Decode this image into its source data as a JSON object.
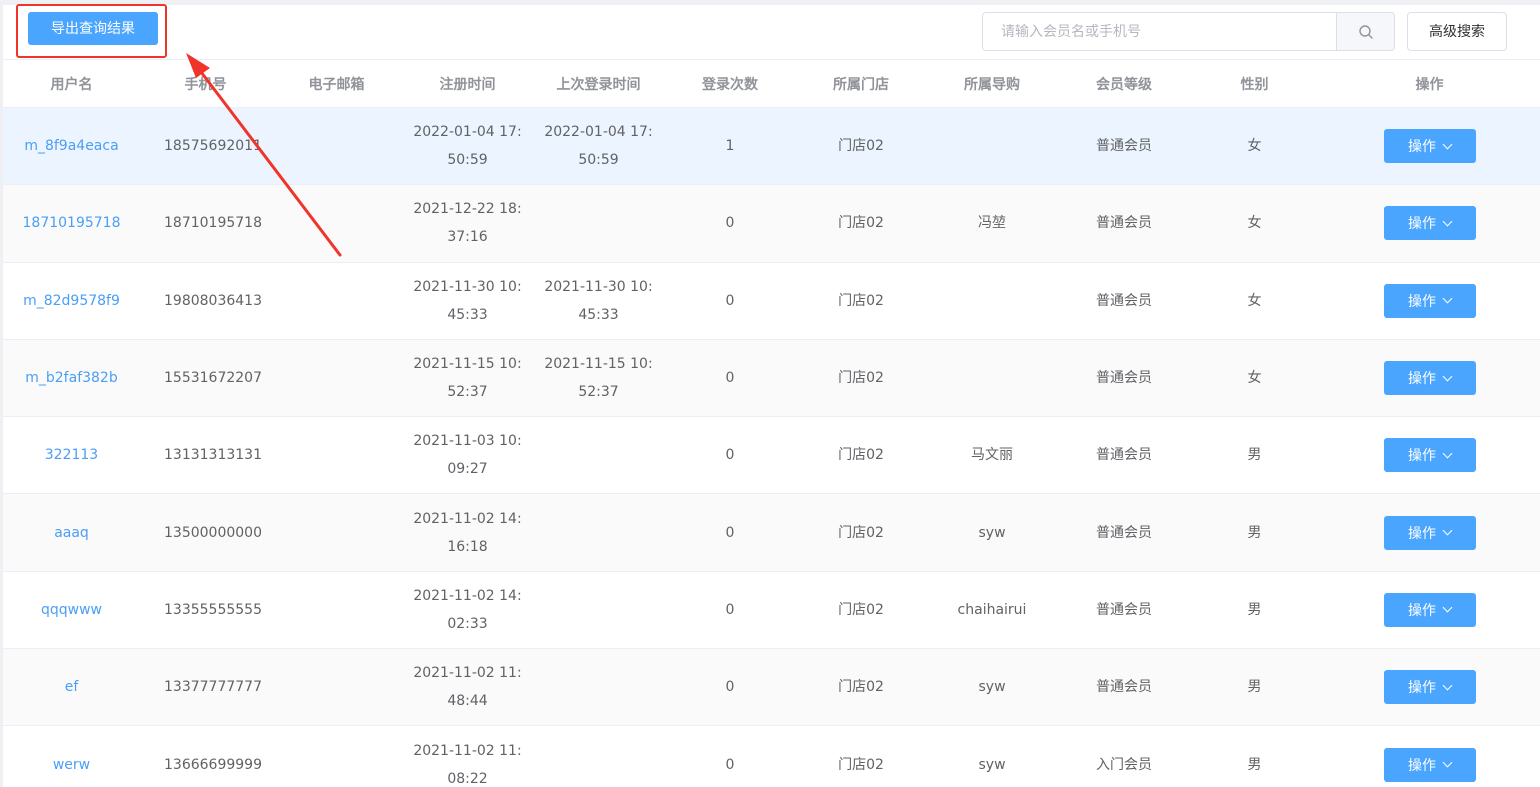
{
  "toolbar": {
    "export_label": "导出查询结果",
    "search_placeholder": "请输入会员名或手机号",
    "advanced_label": "高级搜索"
  },
  "table": {
    "headers": {
      "username": "用户名",
      "phone": "手机号",
      "email": "电子邮箱",
      "register_time": "注册时间",
      "last_login": "上次登录时间",
      "login_count": "登录次数",
      "store": "所属门店",
      "guide": "所属导购",
      "level": "会员等级",
      "gender": "性别",
      "actions": "操作"
    },
    "rows": [
      {
        "username": "m_8f9a4eaca",
        "phone": "18575692011",
        "email": "",
        "reg_date": "2022-01-04 17:",
        "reg_time": "50:59",
        "last_date": "2022-01-04 17:",
        "last_time": "50:59",
        "count": "1",
        "store": "门店02",
        "guide": "",
        "level": "普通会员",
        "gender": "女",
        "action": "操作"
      },
      {
        "username": "18710195718",
        "phone": "18710195718",
        "email": "",
        "reg_date": "2021-12-22 18:",
        "reg_time": "37:16",
        "last_date": "",
        "last_time": "",
        "count": "0",
        "store": "门店02",
        "guide": "冯堃",
        "level": "普通会员",
        "gender": "女",
        "action": "操作"
      },
      {
        "username": "m_82d9578f9",
        "phone": "19808036413",
        "email": "",
        "reg_date": "2021-11-30 10:",
        "reg_time": "45:33",
        "last_date": "2021-11-30 10:",
        "last_time": "45:33",
        "count": "0",
        "store": "门店02",
        "guide": "",
        "level": "普通会员",
        "gender": "女",
        "action": "操作"
      },
      {
        "username": "m_b2faf382b",
        "phone": "15531672207",
        "email": "",
        "reg_date": "2021-11-15 10:",
        "reg_time": "52:37",
        "last_date": "2021-11-15 10:",
        "last_time": "52:37",
        "count": "0",
        "store": "门店02",
        "guide": "",
        "level": "普通会员",
        "gender": "女",
        "action": "操作"
      },
      {
        "username": "322113",
        "phone": "13131313131",
        "email": "",
        "reg_date": "2021-11-03 10:",
        "reg_time": "09:27",
        "last_date": "",
        "last_time": "",
        "count": "0",
        "store": "门店02",
        "guide": "马文丽",
        "level": "普通会员",
        "gender": "男",
        "action": "操作"
      },
      {
        "username": "aaaq",
        "phone": "13500000000",
        "email": "",
        "reg_date": "2021-11-02 14:",
        "reg_time": "16:18",
        "last_date": "",
        "last_time": "",
        "count": "0",
        "store": "门店02",
        "guide": "syw",
        "level": "普通会员",
        "gender": "男",
        "action": "操作"
      },
      {
        "username": "qqqwww",
        "phone": "13355555555",
        "email": "",
        "reg_date": "2021-11-02 14:",
        "reg_time": "02:33",
        "last_date": "",
        "last_time": "",
        "count": "0",
        "store": "门店02",
        "guide": "chaihairui",
        "level": "普通会员",
        "gender": "男",
        "action": "操作"
      },
      {
        "username": "ef",
        "phone": "13377777777",
        "email": "",
        "reg_date": "2021-11-02 11:",
        "reg_time": "48:44",
        "last_date": "",
        "last_time": "",
        "count": "0",
        "store": "门店02",
        "guide": "syw",
        "level": "普通会员",
        "gender": "男",
        "action": "操作"
      },
      {
        "username": "werw",
        "phone": "13666699999",
        "email": "",
        "reg_date": "2021-11-02 11:",
        "reg_time": "08:22",
        "last_date": "",
        "last_time": "",
        "count": "0",
        "store": "门店02",
        "guide": "syw",
        "level": "入门会员",
        "gender": "男",
        "action": "操作"
      }
    ]
  },
  "colors": {
    "primary": "#4aa5ff",
    "link": "#4a9ff5",
    "annotation": "#f0342a",
    "row_hover": "#ecf5ff"
  },
  "icons": {
    "search": "search-icon",
    "dropdown": "chevron-down-icon",
    "annotation_arrow": "arrow-icon"
  }
}
